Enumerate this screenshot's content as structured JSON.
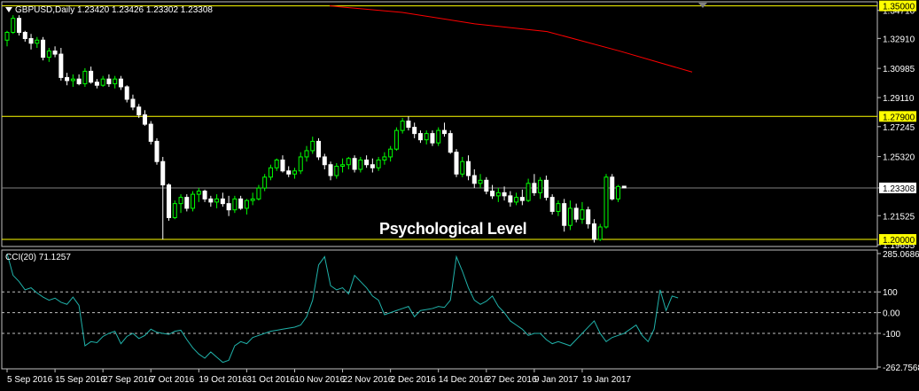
{
  "header": {
    "symbol_info": "GBPUSD,Daily  1.23420 1.23426 1.23302 1.23308",
    "menu_icon": "triangle-down-icon"
  },
  "annotation": "Psychological Level",
  "indicator": {
    "label": "CCI(20) 71.1257"
  },
  "colors": {
    "background": "#000000",
    "bull": "#00ff00",
    "bear": "#ffffff",
    "ma": "#ff0000",
    "level_line": "#ffff00",
    "price_tag": "#ffff00",
    "cci": "#20b2aa",
    "grid": "#c0c0c0"
  },
  "chart_data": {
    "type": "candlestick",
    "price_ticks": [
      "1.34710",
      "1.32910",
      "1.30985",
      "1.29110",
      "1.27245",
      "1.25320",
      "1.23308",
      "1.21525",
      "1.19655"
    ],
    "highlight_tags": [
      "1.35000",
      "1.27900",
      "1.20000"
    ],
    "current_price": "1.23308",
    "cci_ticks": [
      "285.0686",
      "100",
      "0.00",
      "-100",
      "-262.7568"
    ],
    "date_ticks": [
      "5 Sep 2016",
      "15 Sep 2016",
      "27 Sep 2016",
      "7 Oct 2016",
      "19 Oct 2016",
      "31 Oct 2016",
      "10 Nov 2016",
      "22 Nov 2016",
      "2 Dec 2016",
      "14 Dec 2016",
      "27 Dec 2016",
      "9 Jan 2017",
      "19 Jan 2017"
    ],
    "ylim": [
      1.1966,
      1.3515
    ],
    "cci_ylim": [
      -262.7568,
      285.0686
    ],
    "levels": [
      1.35,
      1.279,
      1.2
    ],
    "ma_points": [
      [
        1.35,
        1.3458
      ],
      [
        1.346,
        1.3385
      ],
      [
        1.3385,
        1.3335
      ],
      [
        1.3335,
        1.321
      ],
      [
        1.321,
        1.3075
      ]
    ],
    "candles": [
      [
        1.328,
        1.334,
        1.324,
        1.333
      ],
      [
        1.333,
        1.344,
        1.332,
        1.342
      ],
      [
        1.342,
        1.344,
        1.331,
        1.333
      ],
      [
        1.333,
        1.334,
        1.327,
        1.329
      ],
      [
        1.329,
        1.332,
        1.322,
        1.326
      ],
      [
        1.326,
        1.33,
        1.323,
        1.328
      ],
      [
        1.328,
        1.33,
        1.315,
        1.317
      ],
      [
        1.317,
        1.323,
        1.314,
        1.321
      ],
      [
        1.321,
        1.324,
        1.317,
        1.319
      ],
      [
        1.319,
        1.323,
        1.302,
        1.304
      ],
      [
        1.304,
        1.307,
        1.299,
        1.302
      ],
      [
        1.302,
        1.306,
        1.298,
        1.303
      ],
      [
        1.303,
        1.306,
        1.299,
        1.3
      ],
      [
        1.3,
        1.31,
        1.298,
        1.308
      ],
      [
        1.308,
        1.311,
        1.3,
        1.301
      ],
      [
        1.301,
        1.303,
        1.297,
        1.299
      ],
      [
        1.299,
        1.305,
        1.298,
        1.303
      ],
      [
        1.303,
        1.306,
        1.298,
        1.3
      ],
      [
        1.3,
        1.305,
        1.297,
        1.303
      ],
      [
        1.303,
        1.305,
        1.296,
        1.298
      ],
      [
        1.298,
        1.299,
        1.288,
        1.29
      ],
      [
        1.29,
        1.293,
        1.283,
        1.285
      ],
      [
        1.285,
        1.287,
        1.278,
        1.28
      ],
      [
        1.28,
        1.283,
        1.273,
        1.274
      ],
      [
        1.274,
        1.276,
        1.261,
        1.263
      ],
      [
        1.263,
        1.265,
        1.248,
        1.25
      ],
      [
        1.25,
        1.253,
        1.2,
        1.235
      ],
      [
        1.235,
        1.236,
        1.212,
        1.214
      ],
      [
        1.214,
        1.225,
        1.213,
        1.223
      ],
      [
        1.223,
        1.229,
        1.217,
        1.227
      ],
      [
        1.227,
        1.229,
        1.218,
        1.22
      ],
      [
        1.22,
        1.231,
        1.218,
        1.229
      ],
      [
        1.229,
        1.233,
        1.224,
        1.231
      ],
      [
        1.231,
        1.232,
        1.224,
        1.226
      ],
      [
        1.226,
        1.228,
        1.221,
        1.224
      ],
      [
        1.224,
        1.229,
        1.22,
        1.226
      ],
      [
        1.226,
        1.23,
        1.221,
        1.223
      ],
      [
        1.223,
        1.228,
        1.215,
        1.219
      ],
      [
        1.219,
        1.228,
        1.217,
        1.226
      ],
      [
        1.226,
        1.228,
        1.219,
        1.22
      ],
      [
        1.22,
        1.226,
        1.216,
        1.225
      ],
      [
        1.225,
        1.23,
        1.222,
        1.226
      ],
      [
        1.226,
        1.235,
        1.225,
        1.233
      ],
      [
        1.233,
        1.242,
        1.231,
        1.24
      ],
      [
        1.24,
        1.248,
        1.238,
        1.246
      ],
      [
        1.246,
        1.252,
        1.244,
        1.251
      ],
      [
        1.251,
        1.254,
        1.243,
        1.244
      ],
      [
        1.244,
        1.247,
        1.24,
        1.242
      ],
      [
        1.242,
        1.246,
        1.239,
        1.244
      ],
      [
        1.244,
        1.256,
        1.242,
        1.253
      ],
      [
        1.253,
        1.26,
        1.25,
        1.257
      ],
      [
        1.257,
        1.266,
        1.255,
        1.263
      ],
      [
        1.263,
        1.265,
        1.251,
        1.253
      ],
      [
        1.253,
        1.255,
        1.245,
        1.248
      ],
      [
        1.248,
        1.25,
        1.238,
        1.241
      ],
      [
        1.241,
        1.249,
        1.239,
        1.247
      ],
      [
        1.247,
        1.252,
        1.243,
        1.248
      ],
      [
        1.248,
        1.253,
        1.245,
        1.252
      ],
      [
        1.252,
        1.254,
        1.243,
        1.245
      ],
      [
        1.245,
        1.253,
        1.243,
        1.251
      ],
      [
        1.251,
        1.254,
        1.246,
        1.248
      ],
      [
        1.248,
        1.252,
        1.243,
        1.246
      ],
      [
        1.246,
        1.253,
        1.244,
        1.251
      ],
      [
        1.251,
        1.256,
        1.248,
        1.253
      ],
      [
        1.253,
        1.26,
        1.25,
        1.258
      ],
      [
        1.258,
        1.272,
        1.257,
        1.27
      ],
      [
        1.27,
        1.278,
        1.268,
        1.276
      ],
      [
        1.276,
        1.279,
        1.27,
        1.272
      ],
      [
        1.272,
        1.275,
        1.265,
        1.268
      ],
      [
        1.268,
        1.27,
        1.262,
        1.264
      ],
      [
        1.264,
        1.27,
        1.261,
        1.268
      ],
      [
        1.268,
        1.27,
        1.26,
        1.262
      ],
      [
        1.262,
        1.272,
        1.26,
        1.27
      ],
      [
        1.27,
        1.275,
        1.266,
        1.268
      ],
      [
        1.268,
        1.27,
        1.255,
        1.256
      ],
      [
        1.256,
        1.258,
        1.24,
        1.242
      ],
      [
        1.242,
        1.253,
        1.24,
        1.25
      ],
      [
        1.25,
        1.254,
        1.238,
        1.241
      ],
      [
        1.241,
        1.245,
        1.233,
        1.236
      ],
      [
        1.236,
        1.242,
        1.233,
        1.238
      ],
      [
        1.238,
        1.24,
        1.229,
        1.231
      ],
      [
        1.231,
        1.235,
        1.226,
        1.228
      ],
      [
        1.228,
        1.233,
        1.224,
        1.23
      ],
      [
        1.23,
        1.234,
        1.225,
        1.228
      ],
      [
        1.228,
        1.231,
        1.221,
        1.224
      ],
      [
        1.224,
        1.23,
        1.222,
        1.227
      ],
      [
        1.227,
        1.232,
        1.222,
        1.225
      ],
      [
        1.225,
        1.239,
        1.224,
        1.236
      ],
      [
        1.236,
        1.242,
        1.228,
        1.23
      ],
      [
        1.23,
        1.24,
        1.226,
        1.238
      ],
      [
        1.238,
        1.241,
        1.225,
        1.227
      ],
      [
        1.227,
        1.229,
        1.216,
        1.218
      ],
      [
        1.218,
        1.225,
        1.215,
        1.223
      ],
      [
        1.223,
        1.226,
        1.205,
        1.209
      ],
      [
        1.209,
        1.225,
        1.206,
        1.22
      ],
      [
        1.22,
        1.223,
        1.211,
        1.213
      ],
      [
        1.213,
        1.224,
        1.21,
        1.219
      ],
      [
        1.219,
        1.221,
        1.207,
        1.21
      ],
      [
        1.21,
        1.213,
        1.198,
        1.2
      ],
      [
        1.2,
        1.21,
        1.199,
        1.208
      ],
      [
        1.208,
        1.242,
        1.207,
        1.24
      ],
      [
        1.24,
        1.242,
        1.225,
        1.226
      ],
      [
        1.226,
        1.235,
        1.224,
        1.234
      ],
      [
        1.2342,
        1.2343,
        1.233,
        1.2331
      ]
    ],
    "cci": [
      285,
      180,
      150,
      110,
      120,
      95,
      75,
      60,
      70,
      50,
      40,
      75,
      35,
      -160,
      -140,
      -145,
      -115,
      -100,
      -90,
      -150,
      -115,
      -100,
      -125,
      -110,
      -80,
      -95,
      -100,
      -105,
      -90,
      -85,
      -130,
      -170,
      -200,
      -220,
      -190,
      -215,
      -240,
      -230,
      -160,
      -140,
      -150,
      -120,
      -110,
      -100,
      -90,
      -85,
      -80,
      -75,
      -70,
      -60,
      -20,
      60,
      230,
      270,
      130,
      110,
      120,
      90,
      180,
      150,
      120,
      80,
      60,
      -10,
      0,
      10,
      20,
      30,
      -20,
      10,
      15,
      20,
      30,
      25,
      60,
      270,
      200,
      120,
      60,
      40,
      55,
      80,
      30,
      0,
      -40,
      -60,
      -80,
      -110,
      -100,
      -100,
      -130,
      -150,
      -140,
      -150,
      -160,
      -130,
      -100,
      -70,
      -40,
      -100,
      -140,
      -120,
      -110,
      -100,
      -80,
      -60,
      -110,
      -140,
      -80,
      110,
      10,
      80,
      71
    ]
  }
}
